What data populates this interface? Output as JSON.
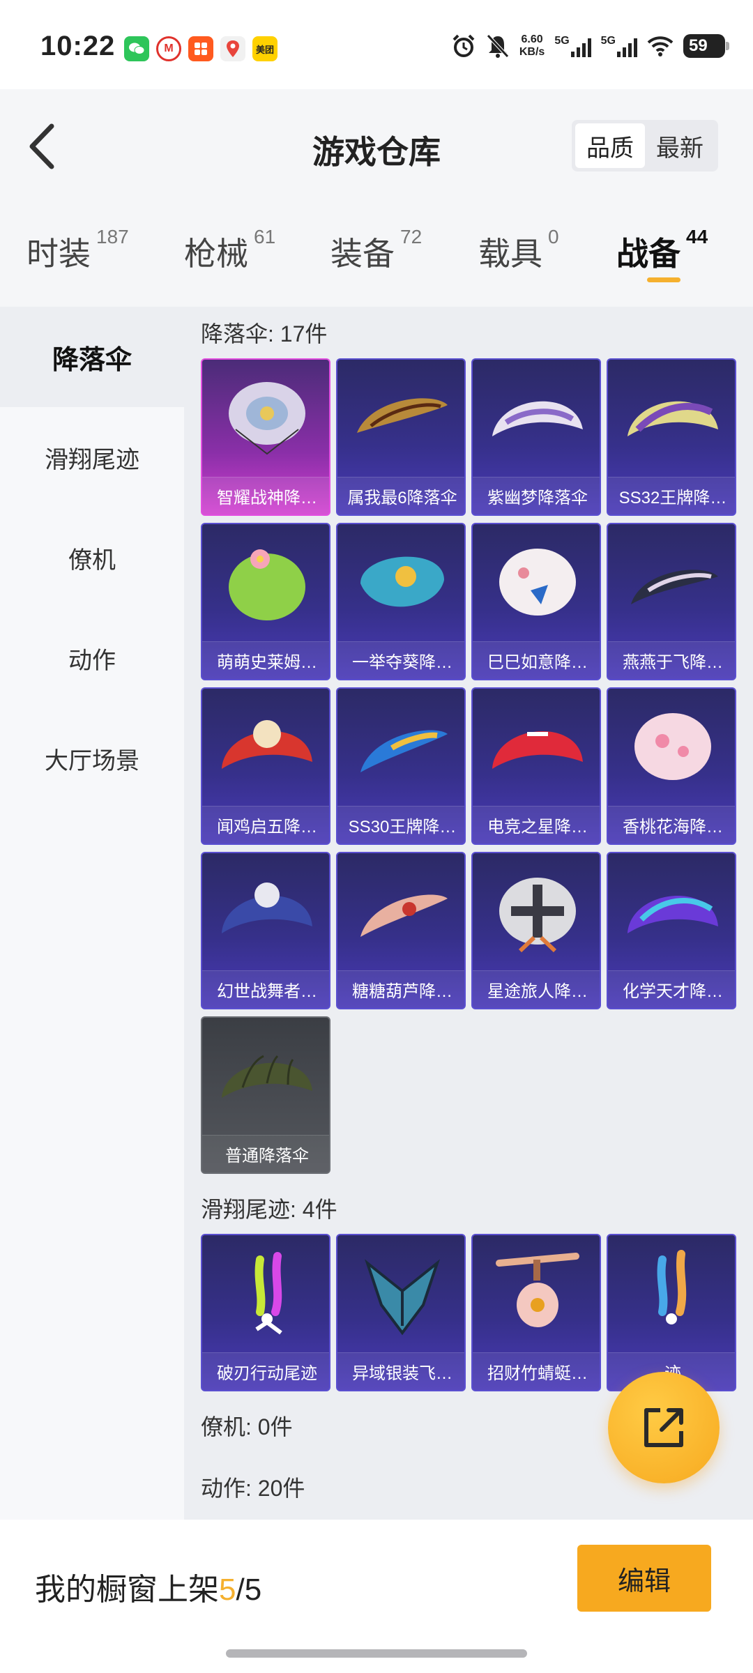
{
  "status_bar": {
    "time": "10:22",
    "net_speed_value": "6.60",
    "net_speed_unit": "KB/s",
    "network_1": "5G",
    "network_2": "5G",
    "battery": "59",
    "app_icons": [
      "wechat-icon",
      "metro-icon",
      "taobao-icon",
      "maps-icon",
      "meituan-icon"
    ],
    "meituan_label": "美团",
    "metro_label": "M"
  },
  "header": {
    "title": "游戏仓库",
    "sort_options": [
      "品质",
      "最新"
    ],
    "active_sort": "品质"
  },
  "tabs": [
    {
      "label": "时装",
      "count": "187"
    },
    {
      "label": "枪械",
      "count": "61"
    },
    {
      "label": "装备",
      "count": "72"
    },
    {
      "label": "载具",
      "count": "0"
    },
    {
      "label": "战备",
      "count": "44"
    }
  ],
  "active_tab": "战备",
  "sidebar": {
    "items": [
      "降落伞",
      "滑翔尾迹",
      "僚机",
      "动作",
      "大厅场景"
    ],
    "active": "降落伞"
  },
  "sections": {
    "parachute": {
      "title": "降落伞: 17件",
      "items": [
        "智耀战神降…",
        "属我最6降落伞",
        "紫幽梦降落伞",
        "SS32王牌降…",
        "萌萌史莱姆…",
        "一举夺葵降…",
        "巳巳如意降…",
        "燕燕于飞降…",
        "闻鸡启五降…",
        "SS30王牌降…",
        "电竞之星降…",
        "香桃花海降…",
        "幻世战舞者…",
        "糖糖葫芦降…",
        "星途旅人降…",
        "化学天才降…",
        "普通降落伞"
      ]
    },
    "trail": {
      "title": "滑翔尾迹: 4件",
      "items": [
        "破刃行动尾迹",
        "异域银装飞…",
        "招财竹蜻蜓…",
        "迹"
      ]
    },
    "wingman": {
      "title": "僚机: 0件"
    },
    "emote": {
      "title": "动作: 20件"
    }
  },
  "bottom_bar": {
    "shelf_prefix": "我的橱窗上架",
    "shelf_current": "5",
    "shelf_total": "/5",
    "edit_label": "编辑"
  },
  "colors": {
    "accent": "#f5b02e",
    "card_epic": "#3a3290",
    "card_legend": "#c83ec8",
    "card_normal": "#4a4d53"
  }
}
